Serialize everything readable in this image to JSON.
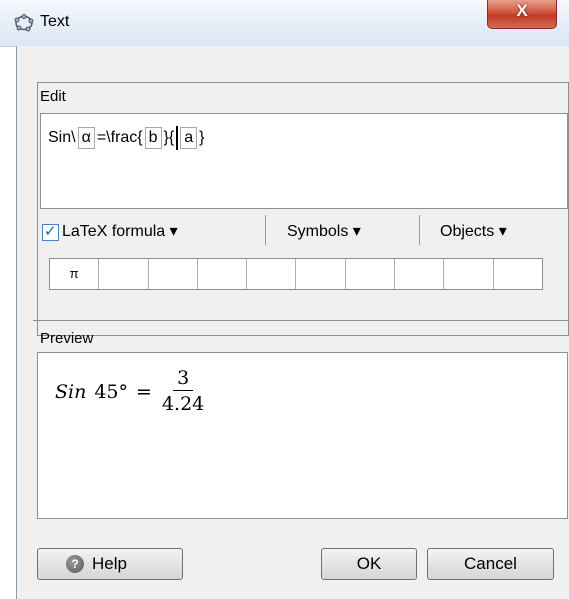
{
  "window": {
    "title": "Text",
    "close_glyph": "X",
    "icon": "geogebra-logo-icon"
  },
  "edit": {
    "label": "Edit",
    "formula_tokens": [
      "Sin\\ ",
      "α",
      " =\\frac{",
      "b",
      "}{",
      "a",
      "}"
    ]
  },
  "toolbar": {
    "latex_checked": true,
    "latex_label": "LaTeX formula ▾",
    "symbols_label": "Symbols ▾",
    "objects_label": "Objects ▾"
  },
  "symbols_row": [
    "π",
    "",
    "",
    "",
    "",
    "",
    "",
    "",
    "",
    ""
  ],
  "preview": {
    "label": "Preview",
    "lhs_func": "Sin",
    "angle": "45°",
    "equals": "=",
    "numerator": "3",
    "denominator": "4.24"
  },
  "buttons": {
    "help": "Help",
    "ok": "OK",
    "cancel": "Cancel"
  },
  "colors": {
    "checkbox_accent": "#1f63b5",
    "close_button": "#c03c26"
  }
}
